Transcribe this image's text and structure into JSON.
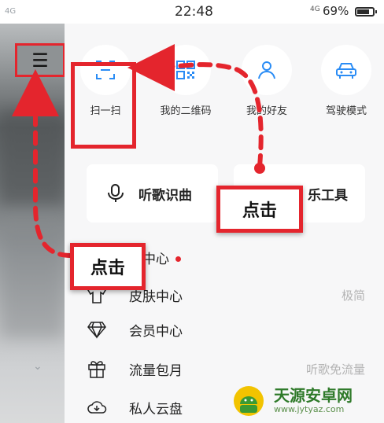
{
  "status_bar": {
    "left_signal": "4G",
    "time": "22:48",
    "signal": "4G",
    "battery": "69%"
  },
  "quick_actions": [
    {
      "label": "扫一扫",
      "icon": "scan-icon"
    },
    {
      "label": "我的二维码",
      "icon": "qrcode-icon"
    },
    {
      "label": "我的好友",
      "icon": "friend-icon"
    },
    {
      "label": "驾驶模式",
      "icon": "car-icon"
    }
  ],
  "cards": [
    {
      "label": "听歌识曲",
      "icon": "mic-icon"
    },
    {
      "label": "乐工具",
      "icon": "tool-icon"
    }
  ],
  "menu_list": [
    {
      "label": "息中心",
      "extra": "",
      "badge": true,
      "icon": "message-icon"
    },
    {
      "label": "皮肤中心",
      "extra": "极简",
      "badge": false,
      "icon": "shirt-icon"
    },
    {
      "label": "会员中心",
      "extra": "",
      "badge": false,
      "icon": "diamond-icon"
    },
    {
      "label": "流量包月",
      "extra": "听歌免流量",
      "badge": false,
      "icon": "gift-icon"
    },
    {
      "label": "私人云盘",
      "extra": "",
      "badge": false,
      "icon": "cloud-icon"
    }
  ],
  "callouts": {
    "top": "点击",
    "left": "点击"
  },
  "watermark": {
    "name": "天源安卓网",
    "url": "www.jytyaz.com"
  },
  "colors": {
    "highlight": "#e4252d",
    "accent": "#2a8cf5"
  }
}
